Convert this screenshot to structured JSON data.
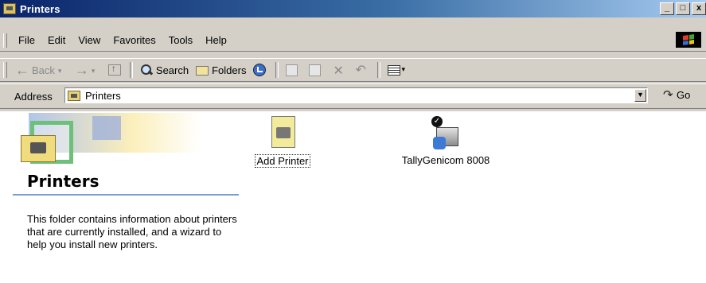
{
  "window": {
    "title": "Printers",
    "controls": [
      "_",
      "□",
      "x"
    ]
  },
  "menu": {
    "items": [
      "File",
      "Edit",
      "View",
      "Favorites",
      "Tools",
      "Help"
    ]
  },
  "toolbar": {
    "back_label": "Back",
    "search_label": "Search",
    "folders_label": "Folders"
  },
  "address": {
    "label": "Address",
    "value": "Printers",
    "go_label": "Go"
  },
  "panel": {
    "heading": "Printers",
    "description": "This folder contains information about printers that are currently installed, and a wizard to help you install new printers."
  },
  "items": [
    {
      "label": "Add Printer",
      "icon": "add-printer-icon"
    },
    {
      "label": "TallyGenicom 8008",
      "icon": "printer-icon",
      "default": true
    }
  ],
  "colors": {
    "title_start": "#0a246a",
    "title_end": "#a6caf0",
    "chrome": "#d4d0c8",
    "rule": "#7aa0cf"
  }
}
